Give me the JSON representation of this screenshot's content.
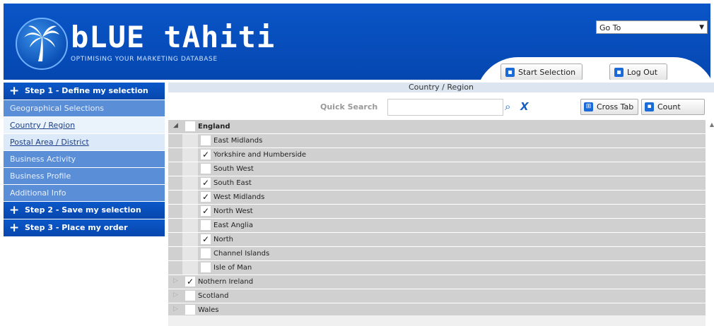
{
  "header": {
    "brand": "bLUE tAhiti",
    "tagline": "OPTIMISING YOUR MARKETING DATABASE",
    "goto_label": "Go To",
    "start_selection": "Start Selection",
    "log_out": "Log Out"
  },
  "sidebar": {
    "step1": "Step 1 - Define my selection",
    "geo": "Geographical Selections",
    "country_region": "Country / Region",
    "postal": "Postal Area / District",
    "business_activity": "Business Activity",
    "business_profile": "Business Profile",
    "additional_info": "Additional Info",
    "step2": "Step 2 - Save my selection",
    "step3": "Step 3 - Place my order"
  },
  "main": {
    "title": "Country / Region",
    "quick_search_label": "Quick Search",
    "quick_search_value": "",
    "cross_tab": "Cross Tab",
    "count": "Count"
  },
  "tree": {
    "england": {
      "label": "England",
      "checked": false
    },
    "children": [
      {
        "label": "East Midlands",
        "checked": false,
        "mark": ""
      },
      {
        "label": "Yorkshire and Humberside",
        "checked": true,
        "mark": "✓"
      },
      {
        "label": "South West",
        "checked": false,
        "mark": ""
      },
      {
        "label": "South East",
        "checked": true,
        "mark": "✓"
      },
      {
        "label": "West Midlands",
        "checked": true,
        "mark": "✓"
      },
      {
        "label": "North West",
        "checked": true,
        "mark": "✓"
      },
      {
        "label": "East Anglia",
        "checked": false,
        "mark": ""
      },
      {
        "label": "North",
        "checked": true,
        "mark": "✓"
      },
      {
        "label": "Channel Islands",
        "checked": false,
        "mark": ""
      },
      {
        "label": "Isle of Man",
        "checked": false,
        "mark": ""
      }
    ],
    "others": [
      {
        "label": "Nothern Ireland",
        "checked": true,
        "mark": "✓"
      },
      {
        "label": "Scotland",
        "checked": false,
        "mark": ""
      },
      {
        "label": "Wales",
        "checked": false,
        "mark": ""
      }
    ]
  },
  "colors": {
    "brand_blue": "#0a55c8",
    "sidebar_blue": "#5a8ed6",
    "row_grey": "#d0d0d0"
  }
}
